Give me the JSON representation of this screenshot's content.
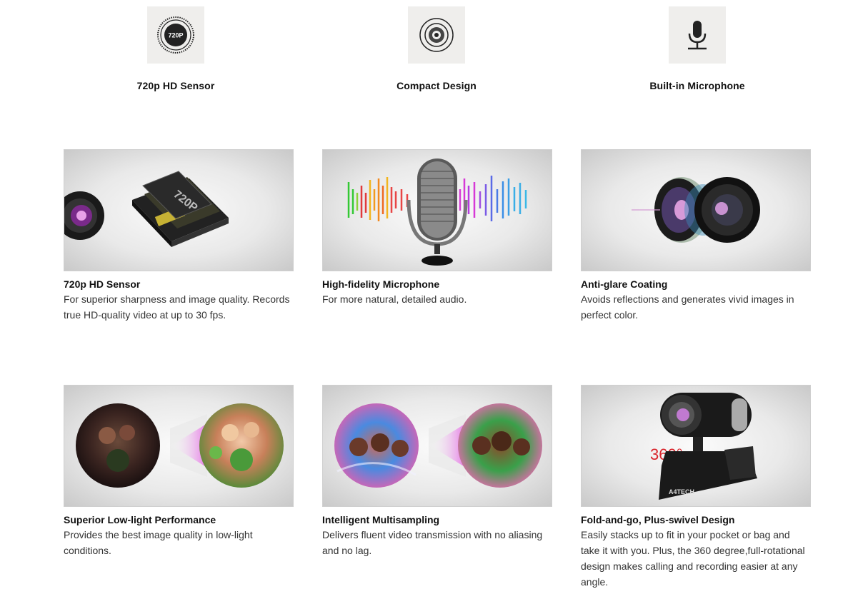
{
  "top_features": [
    {
      "icon": "720p-sensor-icon",
      "label": "720p HD Sensor",
      "icon_text": "720P"
    },
    {
      "icon": "lens-icon",
      "label": "Compact Design"
    },
    {
      "icon": "microphone-icon",
      "label": "Built-in Microphone"
    }
  ],
  "cards": [
    {
      "title": "720p HD Sensor",
      "desc": "For superior sharpness and image quality. Records true HD-quality video at up to 30 fps.",
      "image": "sensor-chip-image",
      "image_text": "720P"
    },
    {
      "title": "High-fidelity Microphone",
      "desc": "For more natural, detailed audio.",
      "image": "microphone-soundwave-image"
    },
    {
      "title": "Anti-glare Coating",
      "desc": "Avoids reflections and generates vivid images in perfect color.",
      "image": "lens-coating-image"
    },
    {
      "title": "Superior Low-light Performance",
      "desc": "Provides the best image quality in low-light conditions.",
      "image": "low-light-comparison-image"
    },
    {
      "title": "Intelligent Multisampling",
      "desc": "Delivers fluent video transmission with no aliasing and no lag.",
      "image": "multisampling-comparison-image"
    },
    {
      "title": "Fold-and-go, Plus-swivel Design",
      "desc": "Easily stacks up to fit in your pocket or bag and take it with you. Plus, the 360 degree,full-rotational design makes calling and recording easier at any angle.",
      "image": "webcam-swivel-image",
      "image_text": "360°",
      "brand_text": "A4TECH"
    }
  ],
  "colors": {
    "icon_box": "#efeeec",
    "accent_red": "#d9242b",
    "magenta": "#e040e0"
  }
}
